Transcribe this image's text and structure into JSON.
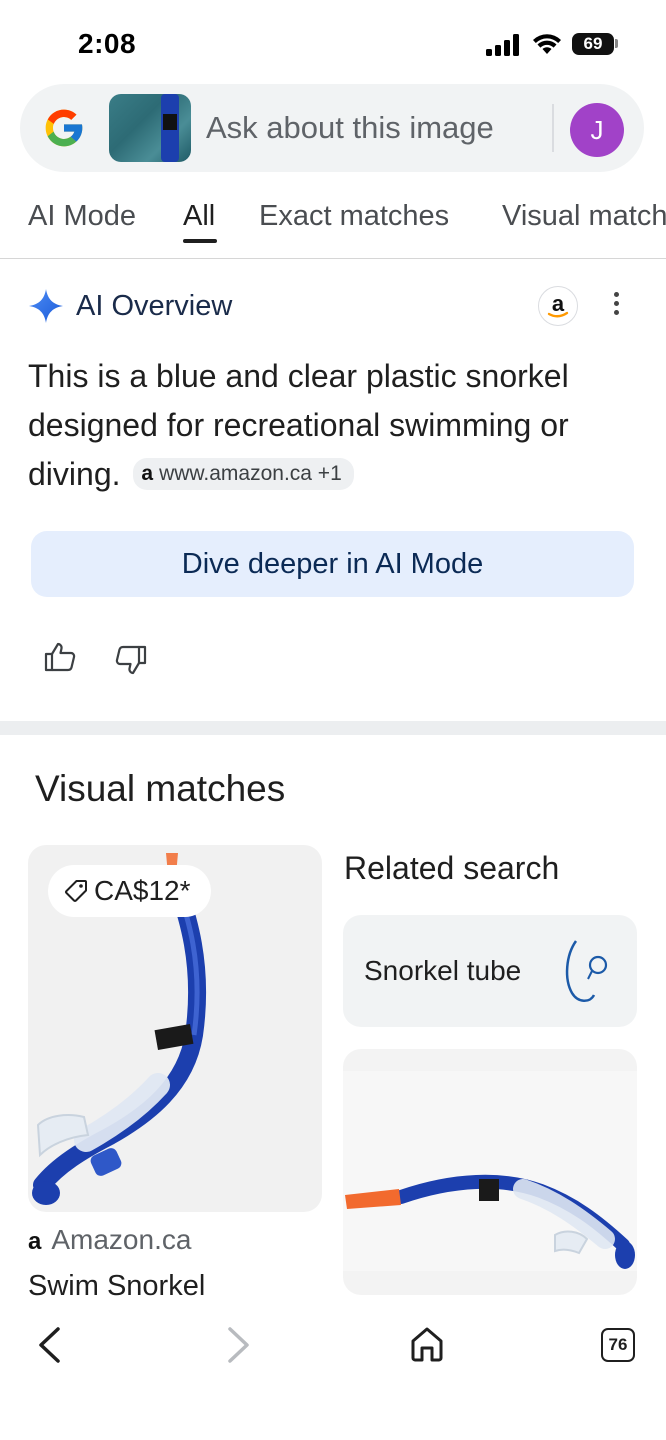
{
  "status_bar": {
    "time": "2:08",
    "battery": "69"
  },
  "search": {
    "placeholder": "Ask about this image",
    "avatar_letter": "J"
  },
  "tabs": [
    {
      "label": "AI Mode",
      "active": false
    },
    {
      "label": "All",
      "active": true
    },
    {
      "label": "Exact matches",
      "active": false
    },
    {
      "label": "Visual matches",
      "active": false
    }
  ],
  "ai_overview": {
    "title": "AI Overview",
    "text": "This is a blue and clear plastic snorkel designed for recreational swimming or diving.",
    "source_chip": "www.amazon.ca +1",
    "source_chip_icon": "a",
    "dive_button": "Dive deeper in AI Mode"
  },
  "visual_matches": {
    "title": "Visual matches",
    "main_item": {
      "price": "CA$12*",
      "source": "Amazon.ca",
      "source_icon": "a",
      "title": "Swim Snorkel"
    },
    "related": {
      "title": "Related search",
      "query": "Snorkel tube"
    }
  },
  "bottom_nav": {
    "tab_count": "76"
  },
  "colors": {
    "accent_blue": "#1a73e8",
    "dive_bg": "#e5eefd",
    "avatar": "#a142c8",
    "snorkel_blue": "#1c3fae",
    "snorkel_tip": "#f26a2e"
  }
}
